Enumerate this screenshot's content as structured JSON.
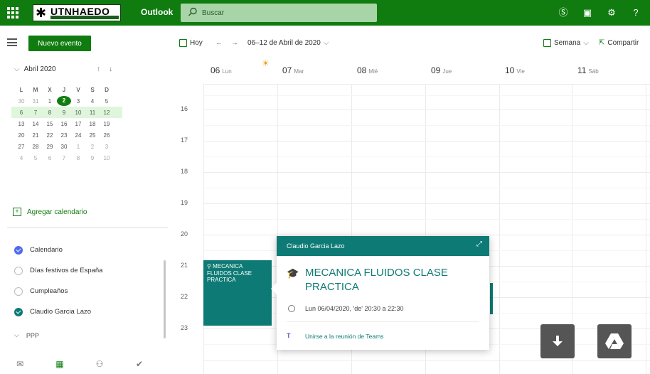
{
  "header": {
    "logo_text": "UTNHAEDO",
    "app_name": "Outlook",
    "search_placeholder": "Buscar"
  },
  "commands": {
    "new_event": "Nuevo evento",
    "today": "Hoy",
    "date_range": "06–12 de Abril de 2020",
    "view": "Semana",
    "share": "Compartir"
  },
  "mini_calendar": {
    "month": "Abril 2020",
    "weekday_initials": [
      "L",
      "M",
      "X",
      "J",
      "V",
      "S",
      "D"
    ],
    "weeks": [
      [
        "30",
        "31",
        "1",
        "2",
        "3",
        "4",
        "5"
      ],
      [
        "6",
        "7",
        "8",
        "9",
        "10",
        "11",
        "12"
      ],
      [
        "13",
        "14",
        "15",
        "16",
        "17",
        "18",
        "19"
      ],
      [
        "20",
        "21",
        "22",
        "23",
        "24",
        "25",
        "26"
      ],
      [
        "27",
        "28",
        "29",
        "30",
        "1",
        "2",
        "3"
      ],
      [
        "4",
        "5",
        "6",
        "7",
        "8",
        "9",
        "10"
      ]
    ],
    "today": "2"
  },
  "sidebar": {
    "add_calendar": "Agregar calendario",
    "calendars": [
      {
        "label": "Calendario",
        "checked": true,
        "color": "#4f6bed"
      },
      {
        "label": "Días festivos de España",
        "checked": false,
        "color": "#ffffff"
      },
      {
        "label": "Cumpleaños",
        "checked": false,
        "color": "#ffffff"
      },
      {
        "label": "Claudio Garcia Lazo",
        "checked": true,
        "color": "#0e7a75"
      }
    ],
    "group": "PPP"
  },
  "week": {
    "days": [
      {
        "num": "06",
        "name": "Lun"
      },
      {
        "num": "07",
        "name": "Mar"
      },
      {
        "num": "08",
        "name": "Mié"
      },
      {
        "num": "09",
        "name": "Jue"
      },
      {
        "num": "10",
        "name": "Vie"
      },
      {
        "num": "11",
        "name": "Sáb"
      }
    ],
    "hours": [
      "16",
      "17",
      "18",
      "19",
      "20",
      "21",
      "22",
      "23"
    ]
  },
  "event": {
    "block_title": "MECANICA FLUIDOS CLASE PRACTICA",
    "owner": "Claudio Garcia Lazo",
    "title": "MECANICA FLUIDOS CLASE PRACTICA",
    "time": "Lun 06/04/2020, 'de' 20:30 a 22:30",
    "teams_link": "Unirse a la reunión de Teams"
  },
  "colors": {
    "brand": "#107c10",
    "event": "#0e7a75"
  }
}
